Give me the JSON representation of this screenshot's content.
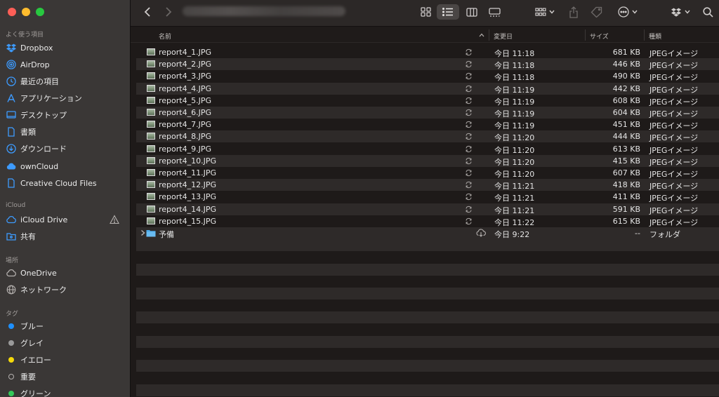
{
  "sidebar": {
    "favorites_header": "よく使う項目",
    "favorites": [
      {
        "label": "Dropbox",
        "icon": "dropbox-icon"
      },
      {
        "label": "AirDrop",
        "icon": "airdrop-icon"
      },
      {
        "label": "最近の項目",
        "icon": "clock-icon"
      },
      {
        "label": "アプリケーション",
        "icon": "applications-icon"
      },
      {
        "label": "デスクトップ",
        "icon": "desktop-icon"
      },
      {
        "label": "書類",
        "icon": "document-icon"
      },
      {
        "label": "ダウンロード",
        "icon": "download-icon"
      },
      {
        "label": "ownCloud",
        "icon": "cloud-icon"
      },
      {
        "label": "Creative Cloud Files",
        "icon": "file-icon"
      }
    ],
    "icloud_header": "iCloud",
    "icloud": [
      {
        "label": "iCloud Drive",
        "icon": "icloud-icon"
      },
      {
        "label": "共有",
        "icon": "shared-folder-icon"
      }
    ],
    "locations_header": "場所",
    "locations": [
      {
        "label": "OneDrive",
        "icon": "cloud-outline-icon"
      },
      {
        "label": "ネットワーク",
        "icon": "globe-icon"
      }
    ],
    "tags_header": "タグ",
    "tags": [
      {
        "label": "ブルー",
        "color": "#1e90ff"
      },
      {
        "label": "グレイ",
        "color": "#9a9a9a"
      },
      {
        "label": "イエロー",
        "color": "#f5d90a"
      },
      {
        "label": "重要",
        "color": "outline"
      },
      {
        "label": "グリーン",
        "color": "#34c759"
      }
    ]
  },
  "columns": {
    "name": "名前",
    "modified": "変更日",
    "size": "サイズ",
    "kind": "種類"
  },
  "files": [
    {
      "name": "report4_1.JPG",
      "date": "今日 11:18",
      "size": "681 KB",
      "kind": "JPEGイメージ"
    },
    {
      "name": "report4_2.JPG",
      "date": "今日 11:18",
      "size": "446 KB",
      "kind": "JPEGイメージ"
    },
    {
      "name": "report4_3.JPG",
      "date": "今日 11:18",
      "size": "490 KB",
      "kind": "JPEGイメージ"
    },
    {
      "name": "report4_4.JPG",
      "date": "今日 11:19",
      "size": "442 KB",
      "kind": "JPEGイメージ"
    },
    {
      "name": "report4_5.JPG",
      "date": "今日 11:19",
      "size": "608 KB",
      "kind": "JPEGイメージ"
    },
    {
      "name": "report4_6.JPG",
      "date": "今日 11:19",
      "size": "604 KB",
      "kind": "JPEGイメージ"
    },
    {
      "name": "report4_7.JPG",
      "date": "今日 11:19",
      "size": "451 KB",
      "kind": "JPEGイメージ"
    },
    {
      "name": "report4_8.JPG",
      "date": "今日 11:20",
      "size": "444 KB",
      "kind": "JPEGイメージ"
    },
    {
      "name": "report4_9.JPG",
      "date": "今日 11:20",
      "size": "613 KB",
      "kind": "JPEGイメージ"
    },
    {
      "name": "report4_10.JPG",
      "date": "今日 11:20",
      "size": "415 KB",
      "kind": "JPEGイメージ"
    },
    {
      "name": "report4_11.JPG",
      "date": "今日 11:20",
      "size": "607 KB",
      "kind": "JPEGイメージ"
    },
    {
      "name": "report4_12.JPG",
      "date": "今日 11:21",
      "size": "418 KB",
      "kind": "JPEGイメージ"
    },
    {
      "name": "report4_13.JPG",
      "date": "今日 11:21",
      "size": "411 KB",
      "kind": "JPEGイメージ"
    },
    {
      "name": "report4_14.JPG",
      "date": "今日 11:21",
      "size": "591 KB",
      "kind": "JPEGイメージ"
    },
    {
      "name": "report4_15.JPG",
      "date": "今日 11:22",
      "size": "615 KB",
      "kind": "JPEGイメージ"
    }
  ],
  "folder": {
    "name": "予備",
    "date": "今日 9:22",
    "size": "--",
    "kind": "フォルダ"
  },
  "colors": {
    "accent_blue": "#1e90ff",
    "folder_blue": "#4aa8e8"
  }
}
